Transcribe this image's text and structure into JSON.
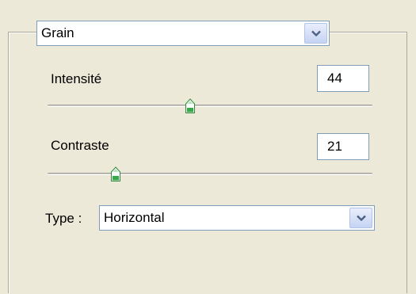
{
  "effect_select": {
    "value": "Grain",
    "arrow_icon": "chevron-down-icon"
  },
  "intensite": {
    "label": "Intensité",
    "value": "44",
    "slider_fraction": 0.44
  },
  "contraste": {
    "label": "Contraste",
    "value": "21",
    "slider_fraction": 0.21
  },
  "type": {
    "label": "Type :",
    "value": "Horizontal",
    "arrow_icon": "chevron-down-icon"
  },
  "colors": {
    "panel_bg": "#ece9d8",
    "field_border": "#7f9db9",
    "thumb_green": "#3aa84a"
  }
}
